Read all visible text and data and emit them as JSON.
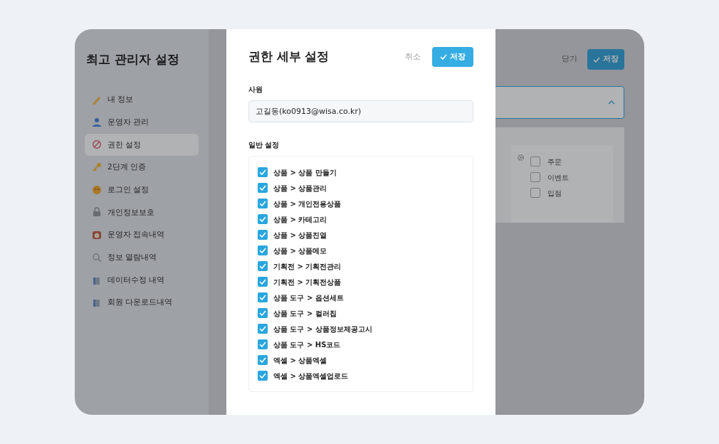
{
  "sidebar": {
    "title": "최고 관리자 설정",
    "items": [
      {
        "label": "내 정보",
        "selected": false
      },
      {
        "label": "운영자 관리",
        "selected": false
      },
      {
        "label": "권한 설정",
        "selected": true
      },
      {
        "label": "2단계 인증",
        "selected": false
      },
      {
        "label": "로그인 설정",
        "selected": false
      },
      {
        "label": "개인정보보호",
        "selected": false
      },
      {
        "label": "운영자 접속내역",
        "selected": false
      },
      {
        "label": "정보 열람내역",
        "selected": false
      },
      {
        "label": "데이터수정 내역",
        "selected": false
      },
      {
        "label": "회원 다운로드내역",
        "selected": false
      }
    ]
  },
  "main": {
    "close_label": "닫기",
    "save_label": "저장",
    "section": {
      "expanded": true
    },
    "options": [
      {
        "label": "주문",
        "checked": false
      },
      {
        "label": "이벤트",
        "checked": false
      },
      {
        "label": "입점",
        "checked": false
      }
    ]
  },
  "dialog": {
    "title": "권한 세부 설정",
    "cancel_label": "취소",
    "save_label": "저장",
    "employee_label": "사원",
    "employee_value": "고길동(ko0913@wisa.co.kr)",
    "general_label": "일반 설정",
    "permissions": [
      {
        "label": "상품 > 상품 만들기",
        "checked": true
      },
      {
        "label": "상품 > 상품관리",
        "checked": true
      },
      {
        "label": "상품 > 개인전용상품",
        "checked": true
      },
      {
        "label": "상품 > 카테고리",
        "checked": true
      },
      {
        "label": "상품 > 상품진열",
        "checked": true
      },
      {
        "label": "상품 > 상품메모",
        "checked": true
      },
      {
        "label": "기획전 > 기획전관리",
        "checked": true
      },
      {
        "label": "기획전 > 기획전상품",
        "checked": true
      },
      {
        "label": "상품 도구 > 옵션세트",
        "checked": true
      },
      {
        "label": "상품 도구 > 컬러칩",
        "checked": true
      },
      {
        "label": "상품 도구 > 상품정보제공고시",
        "checked": true
      },
      {
        "label": "상품 도구 > HS코드",
        "checked": true
      },
      {
        "label": "엑셀 > 상품엑셀",
        "checked": true
      },
      {
        "label": "엑셀 > 상품엑셀업로드",
        "checked": true
      }
    ]
  }
}
